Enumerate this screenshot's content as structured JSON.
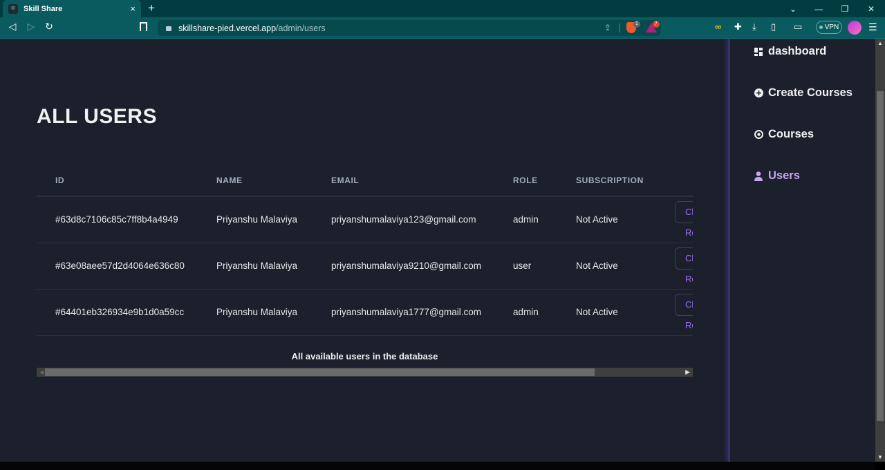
{
  "browser": {
    "tab_title": "Skill Share",
    "tab_close": "×",
    "new_tab": "+",
    "url_host": "skillshare-pied.vercel.app",
    "url_path": "/admin/users",
    "shield_count": "1",
    "rewards_count": "7",
    "vpn_label": "VPN",
    "win_controls": {
      "dropdown": "⌄",
      "minimize": "—",
      "restore": "❐",
      "close": "✕"
    },
    "nav": {
      "back": "◁",
      "forward": "▷",
      "reload": "↻"
    },
    "menu": "☰"
  },
  "page": {
    "title": "ALL USERS",
    "table": {
      "headers": [
        "ID",
        "NAME",
        "EMAIL",
        "ROLE",
        "SUBSCRIPTION"
      ],
      "rows": [
        {
          "id": "#63d8c7106c85c7ff8b4a4949",
          "name": "Priyanshu Malaviya",
          "email": "priyanshumalaviya123@gmail.com",
          "role": "admin",
          "subscription": "Not Active",
          "action": "Change Role"
        },
        {
          "id": "#63e08aee57d2d4064e636c80",
          "name": "Priyanshu Malaviya",
          "email": "priyanshumalaviya9210@gmail.com",
          "role": "user",
          "subscription": "Not Active",
          "action": "Change Role"
        },
        {
          "id": "#64401eb326934e9b1d0a59cc",
          "name": "Priyanshu Malaviya",
          "email": "priyanshumalaviya1777@gmail.com",
          "role": "admin",
          "subscription": "Not Active",
          "action": "Change Role"
        }
      ],
      "caption": "All available users in the database"
    }
  },
  "sidebar": {
    "items": [
      {
        "label": "dashboard",
        "icon": "dashboard-icon",
        "active": false
      },
      {
        "label": "Create Courses",
        "icon": "plus-circle-icon",
        "active": false
      },
      {
        "label": "Courses",
        "icon": "eye-icon",
        "active": false
      },
      {
        "label": "Users",
        "icon": "user-icon",
        "active": true
      }
    ]
  },
  "colors": {
    "background": "#1b202c",
    "active_nav": "#c9a6f2",
    "accent": "#9b6cf0",
    "browser_chrome": "#0a5b5f"
  }
}
